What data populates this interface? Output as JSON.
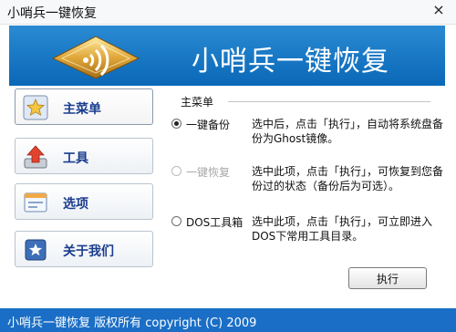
{
  "window": {
    "title": "小哨兵一键恢复",
    "close_glyph": "×"
  },
  "banner": {
    "title": "小哨兵一键恢复"
  },
  "nav": [
    {
      "label": "主菜单",
      "icon": "star-icon"
    },
    {
      "label": "工具",
      "icon": "upload-arrow-icon"
    },
    {
      "label": "选项",
      "icon": "window-icon"
    },
    {
      "label": "关于我们",
      "icon": "badge-star-icon"
    }
  ],
  "main": {
    "group_title": "主菜单",
    "options": [
      {
        "name": "一键备份",
        "desc": "选中后，点击「执行」，自动将系统盘备份为Ghost镜像。",
        "selected": true,
        "enabled": true
      },
      {
        "name": "一键恢复",
        "desc": "选中此项，点击「执行」，可恢复到您备份过的状态（备份后为可选）。",
        "selected": false,
        "enabled": false
      },
      {
        "name": "DOS工具箱",
        "desc": "选中此项，点击「执行」，可立即进入DOS下常用工具目录。",
        "selected": false,
        "enabled": true
      }
    ],
    "execute_label": "执行"
  },
  "status_bar": {
    "text": "小哨兵一键恢复  版权所有  copyright (C) 2009"
  },
  "colors": {
    "banner": "#0a68b8",
    "status": "#1a6ec5",
    "nav_text": "#1b3d8f"
  }
}
